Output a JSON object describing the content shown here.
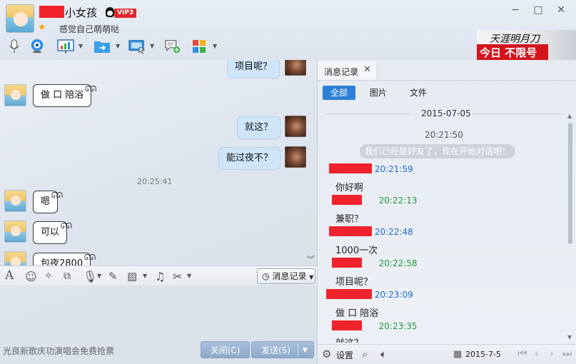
{
  "header": {
    "contact_name": "小女孩",
    "vip_badge": "VIP3",
    "signature": "感觉自己萌萌哒",
    "icons": [
      "microphone-icon",
      "video-camera-icon",
      "presentation-icon",
      "file-transfer-icon",
      "remote-desktop-icon",
      "sms-add-icon",
      "apps-grid-icon"
    ]
  },
  "window_controls": {
    "minimize": "−",
    "maximize": "□",
    "close": "✕"
  },
  "ad": {
    "calligraphy": "天涯明月刀",
    "slogan": "今日 不限号"
  },
  "chat": {
    "messages": [
      {
        "side": "right",
        "text": "项目呢？"
      },
      {
        "side": "left",
        "text": "做 口 陪浴"
      },
      {
        "side": "right",
        "text": "就这？"
      },
      {
        "side": "right",
        "text": "能过夜不？"
      },
      {
        "side": "left",
        "text": "嗯"
      },
      {
        "side": "left",
        "text": "可以"
      },
      {
        "side": "left",
        "text": "包夜2800"
      }
    ],
    "time_divider": "20:25:41"
  },
  "input_toolbar": {
    "message_record_label": "消息记录",
    "icons": [
      "font-icon",
      "emoji-icon",
      "shake-icon",
      "gif-icon",
      "voice-icon",
      "edit-icon",
      "image-icon",
      "music-icon",
      "screenshot-icon"
    ]
  },
  "bottom": {
    "promo": "光良新歌庆功演唱会免费抢票",
    "close_label": "关闭(C)",
    "send_label": "发送(S)"
  },
  "record_panel": {
    "tab_title": "消息记录",
    "filters": [
      "全部",
      "图片",
      "文件"
    ],
    "date": "2015-07-05",
    "start_time": "20:21:50",
    "system_notice": "我们已经是好友了，现在开始对话吧！",
    "entries": [
      {
        "color": "blue",
        "time": "20:21:59",
        "text": "你好啊"
      },
      {
        "color": "green",
        "time": "20:22:13",
        "text": "兼职？"
      },
      {
        "color": "blue",
        "time": "20:22:48",
        "text": "1000一次"
      },
      {
        "color": "green",
        "time": "20:22:58",
        "text": "项目呢？"
      },
      {
        "color": "blue",
        "time": "20:23:09",
        "text": "做 口 陪浴"
      },
      {
        "color": "green",
        "time": "20:23:35",
        "text": "就这？"
      }
    ],
    "footer": {
      "settings_label": "设置",
      "date": "2015-7-5"
    }
  },
  "colors": {
    "accent_blue": "#2e7fd6",
    "redaction": "#f0222c",
    "time_blue": "#1d6ad0",
    "time_green": "#1d9a3c"
  }
}
